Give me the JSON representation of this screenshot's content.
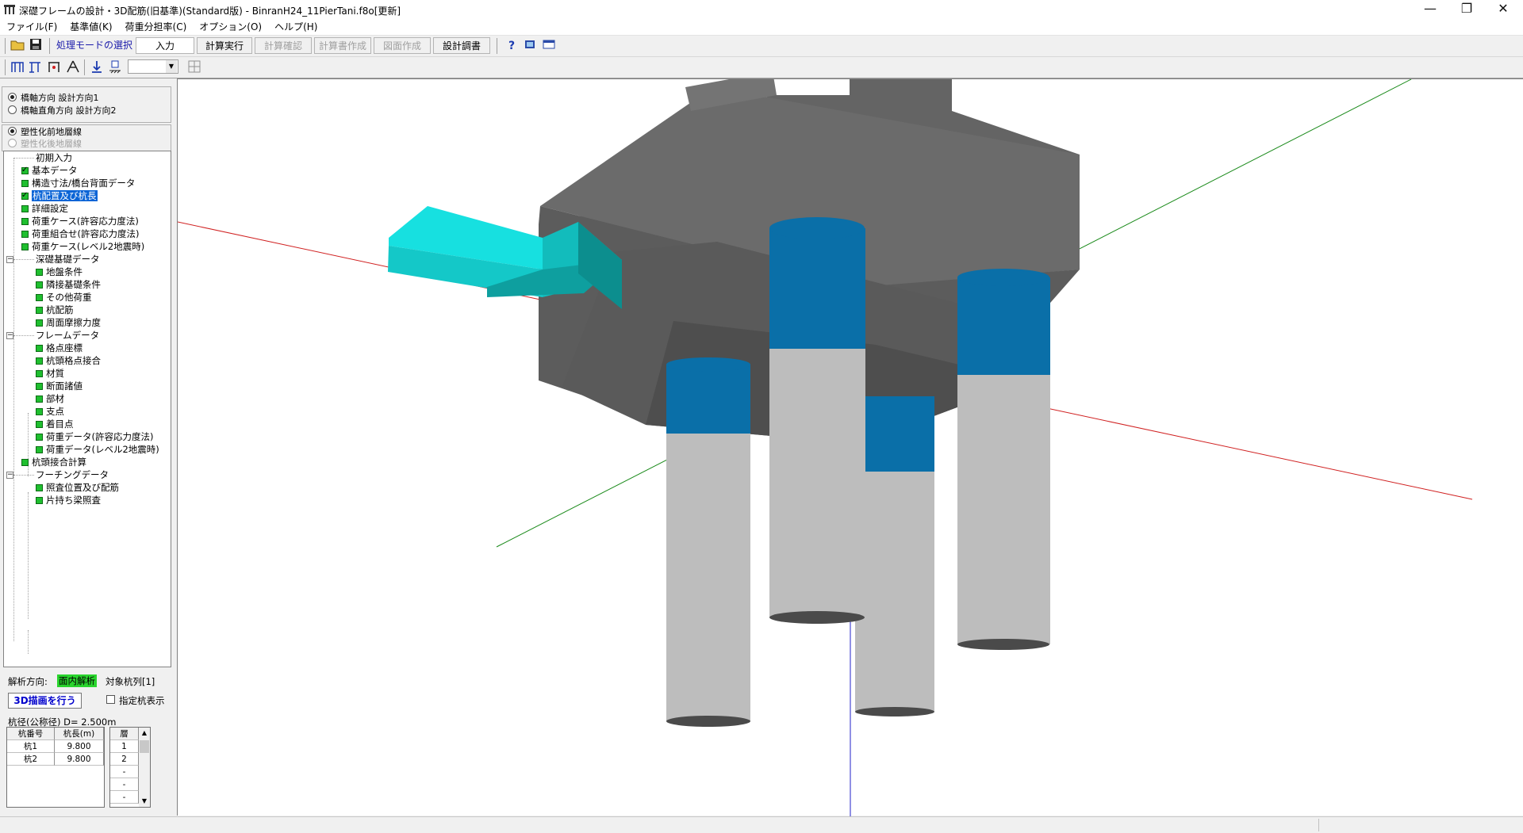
{
  "window": {
    "title": "深礎フレームの設計・3D配筋(旧基準)(Standard版) - BinranH24_11PierTani.f8o[更新]",
    "minimize": "—",
    "maximize": "❐",
    "close": "✕"
  },
  "menu": [
    "ファイル(F)",
    "基準値(K)",
    "荷重分担率(C)",
    "オプション(O)",
    "ヘルプ(H)"
  ],
  "toolbar": {
    "mode_label": "処理モードの選択",
    "input": "入力",
    "calc_run": "計算実行",
    "calc_check": "計算確認",
    "report": "計算書作成",
    "drawing": "図面作成",
    "design_report": "設計調書",
    "help_icon": "?",
    "combo_value": ""
  },
  "left": {
    "direction_radios": [
      {
        "label": "橋軸方向 設計方向1",
        "selected": true,
        "enabled": true
      },
      {
        "label": "橋軸直角方向 設計方向2",
        "selected": false,
        "enabled": true
      }
    ],
    "layer_radios": [
      {
        "label": "塑性化前地層線",
        "selected": true,
        "enabled": true
      },
      {
        "label": "塑性化後地層線",
        "selected": false,
        "enabled": false
      }
    ],
    "tree": [
      "初期入力",
      "基本データ",
      "構造寸法/橋台背面データ",
      "杭配置及び杭長",
      "詳細設定",
      "荷重ケース(許容応力度法)",
      "荷重組合せ(許容応力度法)",
      "荷重ケース(レベル2地震時)",
      "深礎基礎データ",
      "地盤条件",
      "隣接基礎条件",
      "その他荷重",
      "杭配筋",
      "周面摩擦力度",
      "フレームデータ",
      "格点座標",
      "杭頭格点接合",
      "材質",
      "断面諸値",
      "部材",
      "支点",
      "着目点",
      "荷重データ(許容応力度法)",
      "荷重データ(レベル2地震時)",
      "杭頭接合計算",
      "フーチングデータ",
      "照査位置及び配筋",
      "片持ち梁照査"
    ],
    "analysis_label": "解析方向:",
    "analysis_value": "面内解析",
    "target_label": "対象杭列[1]",
    "draw3d_button": "3D描画を行う",
    "show_pile_label": "指定杭表示",
    "pile_dia": "杭径(公称径) D= 2.500m",
    "pile_table": {
      "headers": [
        "杭番号",
        "杭長(m)"
      ],
      "rows": [
        [
          "杭1",
          "9.800"
        ],
        [
          "杭2",
          "9.800"
        ]
      ]
    },
    "layer_table": {
      "header": "層",
      "rows": [
        "1",
        "2",
        "-",
        "-",
        "-"
      ]
    }
  },
  "colors": {
    "footing_top": "#707070",
    "footing_side": "#5a5a5a",
    "pile_band": "#0a6fa8",
    "pile_body": "#c4c4c4",
    "arrow": "#14c8c8",
    "axis_x": "#d02020",
    "axis_y": "#1a8a1a",
    "axis_z": "#2020c8"
  }
}
